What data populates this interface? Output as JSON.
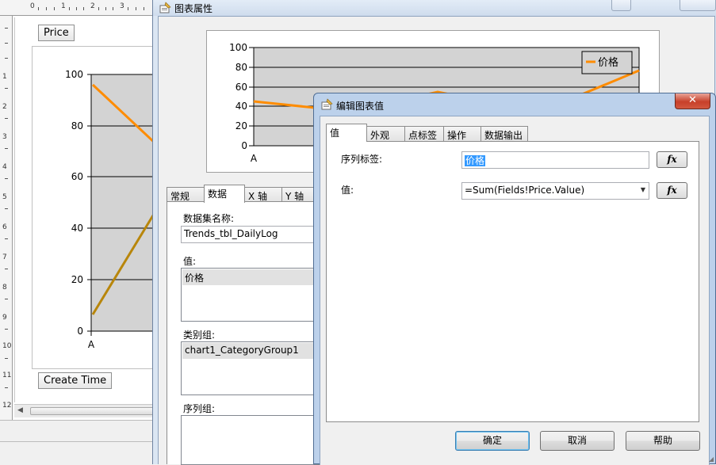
{
  "designer": {
    "ruler_numbers_top": [
      "0",
      "1",
      "2",
      "3"
    ],
    "ruler_numbers_left": [
      "1",
      "2",
      "3",
      "4",
      "5",
      "6",
      "7",
      "8",
      "9",
      "10",
      "11",
      "12"
    ],
    "data_field_button": "Price",
    "category_field_button": "Create Time",
    "chart": {
      "y_ticks": [
        "100",
        "80",
        "60",
        "40",
        "20",
        "0"
      ],
      "x_tick": "A"
    }
  },
  "props_dialog": {
    "title": "图表属性",
    "preview": {
      "y_ticks": [
        "100",
        "80",
        "60",
        "40",
        "20",
        "0"
      ],
      "x_tick": "A",
      "legend": "价格"
    },
    "tabs": [
      "常规",
      "数据",
      "X 轴",
      "Y 轴"
    ],
    "active_tab": "数据",
    "data_tab": {
      "dataset_label": "数据集名称:",
      "dataset_value": "Trends_tbl_DailyLog",
      "values_label": "值:",
      "values_item": "价格",
      "category_groups_label": "类别组:",
      "category_groups_item": "chart1_CategoryGroup1",
      "series_groups_label": "序列组:"
    }
  },
  "edit_dialog": {
    "title": "编辑图表值",
    "close": "✕",
    "tabs": [
      "值",
      "外观",
      "点标签",
      "操作",
      "数据输出"
    ],
    "active_tab": "值",
    "series_label_caption": "序列标签:",
    "series_label_value": "价格",
    "value_caption": "值:",
    "value_expression": "=Sum(Fields!Price.Value)",
    "fx_label": "fx",
    "buttons": {
      "ok": "确定",
      "cancel": "取消",
      "help": "帮助"
    }
  },
  "colors": {
    "series_orange": "#ff8c00",
    "series_dark": "#b8860b",
    "plot_bg": "#d3d3d3",
    "selection": "#3399ff",
    "dialog_frame": "#bcd1eb"
  }
}
